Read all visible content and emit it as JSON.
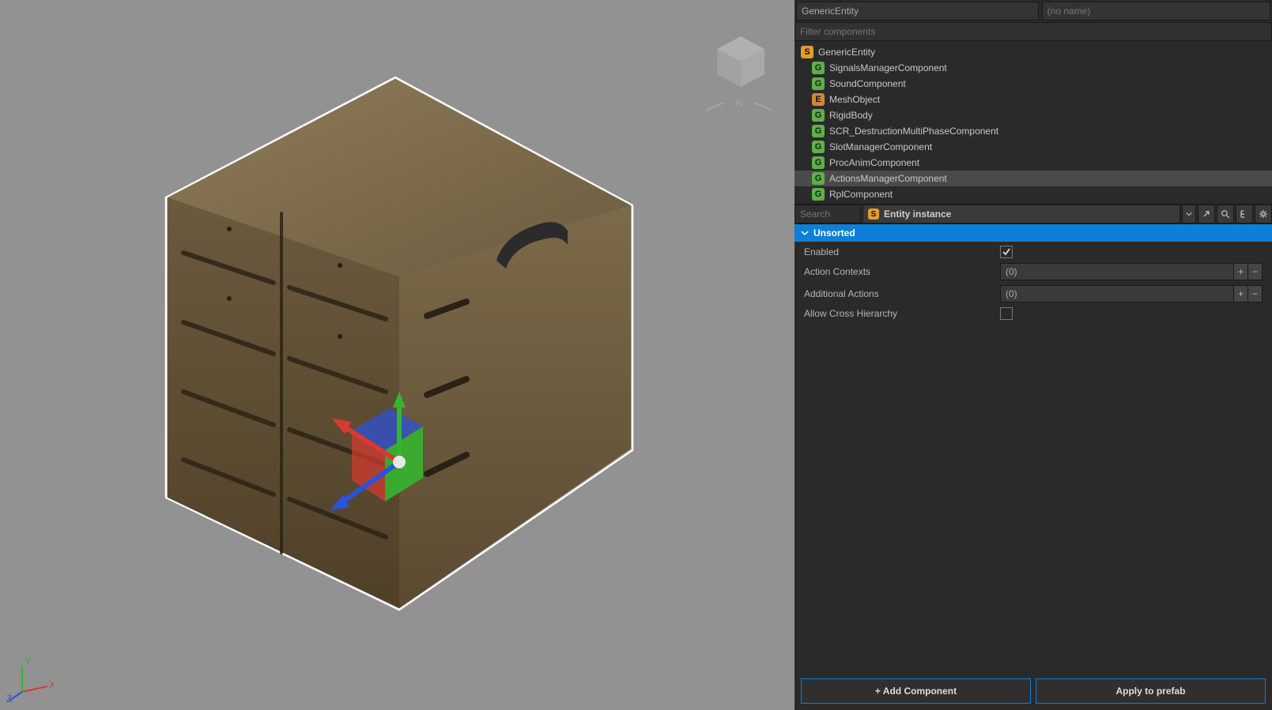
{
  "header": {
    "entity": "GenericEntity",
    "name_placeholder": "(no name)"
  },
  "filter_placeholder": "Filter components",
  "tree": {
    "root": {
      "badge": "S",
      "label": "GenericEntity"
    },
    "children": [
      {
        "badge": "G",
        "label": "SignalsManagerComponent"
      },
      {
        "badge": "G",
        "label": "SoundComponent"
      },
      {
        "badge": "E",
        "label": "MeshObject"
      },
      {
        "badge": "G",
        "label": "RigidBody"
      },
      {
        "badge": "G",
        "label": "SCR_DestructionMultiPhaseComponent"
      },
      {
        "badge": "G",
        "label": "SlotManagerComponent"
      },
      {
        "badge": "G",
        "label": "ProcAnimComponent"
      },
      {
        "badge": "G",
        "label": "ActionsManagerComponent",
        "selected": true
      },
      {
        "badge": "G",
        "label": "RplComponent"
      }
    ]
  },
  "search_placeholder": "Search",
  "instance_label": "Entity instance",
  "section_title": "Unsorted",
  "props": {
    "enabled": {
      "label": "Enabled",
      "checked": true
    },
    "action_contexts": {
      "label": "Action Contexts",
      "count": "(0)"
    },
    "additional_actions": {
      "label": "Additional Actions",
      "count": "(0)"
    },
    "allow_cross": {
      "label": "Allow Cross Hierarchy",
      "checked": false
    }
  },
  "buttons": {
    "add": "+ Add Component",
    "apply": "Apply to prefab"
  },
  "axes": {
    "x": "X",
    "y": "Y",
    "z": "Z"
  },
  "compass": {
    "n": "N"
  },
  "colors": {
    "accent": "#0e7fd6",
    "axis_x": "#d83a2f",
    "axis_y": "#35b52f",
    "axis_z": "#2a52e0"
  }
}
